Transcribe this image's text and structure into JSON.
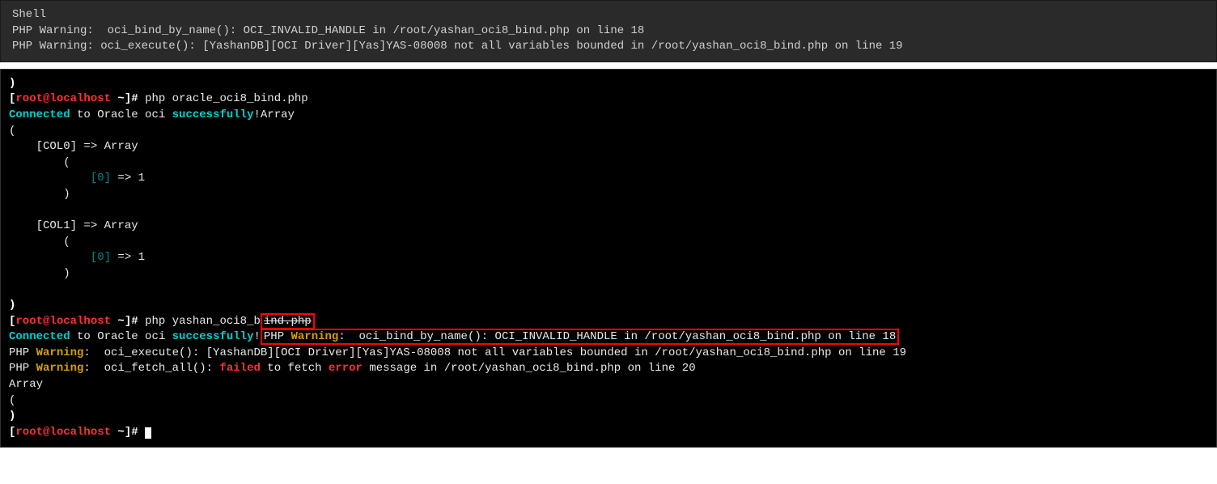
{
  "top": {
    "title": "Shell",
    "line1": "PHP Warning:  oci_bind_by_name(): OCI_INVALID_HANDLE in /root/yashan_oci8_bind.php on line 18",
    "line2": "PHP Warning: oci_execute(): [YashanDB][OCI Driver][Yas]YAS-08008 not all variables bounded in /root/yashan_oci8_bind.php on line 19"
  },
  "term": {
    "paren_close": ")",
    "paren_open": "(",
    "prompt_open": "[",
    "prompt_user": "root@localhost",
    "prompt_mid": " ~",
    "prompt_close": "]# ",
    "cmd1": "php oracle_oci8_bind.php",
    "conn1": "Connected",
    "conn2": " to Oracle oci ",
    "conn3": "successfully",
    "conn_bang_array": "!Array",
    "col0": "    [COL0] => Array",
    "indent_paren_o": "        (",
    "idx0": "            [0]",
    "arrow_1": " => 1",
    "indent_paren_c": "        )",
    "col1": "    [COL1] => Array",
    "cmd2_pre": "php yashan_oci8_b",
    "cmd2_strike": "ind.php",
    "exclam": "!",
    "php_label": "PHP ",
    "warning": "Warning",
    "colon": ":  ",
    "colon1": ": ",
    "w1_msg": "oci_bind_by_name(): OCI_INVALID_HANDLE in /root/yashan_oci8_bind.php on line 18",
    "w2_msg": " oci_execute(): [YashanDB][OCI Driver][Yas]YAS-08008 not all variables bounded in /root/yashan_oci8_bind.php on line 19",
    "w3_a": " oci_fetch_all(): ",
    "w3_failed": "failed",
    "w3_b": " to fetch ",
    "w3_error": "error",
    "w3_c": " message in /root/yashan_oci8_bind.php on line 20",
    "array_word": "Array"
  }
}
